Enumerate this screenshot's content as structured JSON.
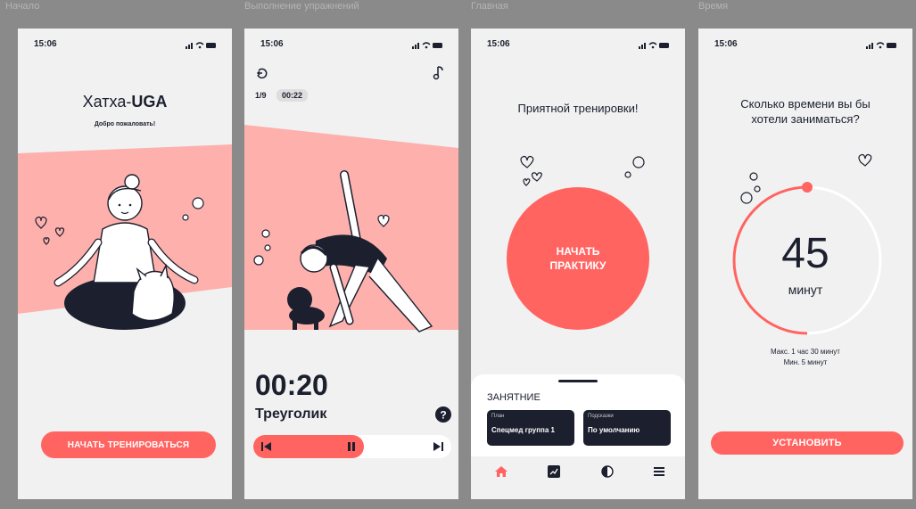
{
  "frames": [
    {
      "label": "Начало"
    },
    {
      "label": "Выполнение упражнений"
    },
    {
      "label": "Главная"
    },
    {
      "label": "Время"
    }
  ],
  "status_time": "15:06",
  "colors": {
    "accent": "#ff6461",
    "band": "#fdb0ac",
    "dark": "#1b1f2e",
    "bg": "#f1f1f1"
  },
  "start": {
    "title_prefix": "Хатха-",
    "title_brand": "UGA",
    "subtitle": "Добро пожаловать!",
    "cta": "НАЧАТЬ ТРЕНИРОВАТЬСЯ"
  },
  "exercise": {
    "progress": "1/9",
    "elapsed": "00:22",
    "timer": "00:20",
    "name": "Треуголик",
    "help_icon": "question-circle-icon",
    "back_icon": "back-arrow-icon",
    "music_icon": "music-note-icon"
  },
  "home": {
    "greeting": "Приятной тренировки!",
    "start_line1": "НАЧАТЬ",
    "start_line2": "ПРАКТИКУ",
    "section_title": "ЗАНЯТНИЕ",
    "plan_label": "План",
    "plan_value": "Спецмед группа 1",
    "hints_label": "Подсказки",
    "hints_value": "По умолчанию",
    "nav": [
      "home-icon",
      "chart-icon",
      "half-circle-icon",
      "menu-icon"
    ]
  },
  "time": {
    "question": "Сколько времени вы бы хотели заниматься?",
    "value": "45",
    "unit": "минут",
    "max": "Макс. 1 час 30 минут",
    "min": "Мин. 5 минут",
    "set": "УСТАНОВИТЬ",
    "progress_fraction": 0.5
  }
}
